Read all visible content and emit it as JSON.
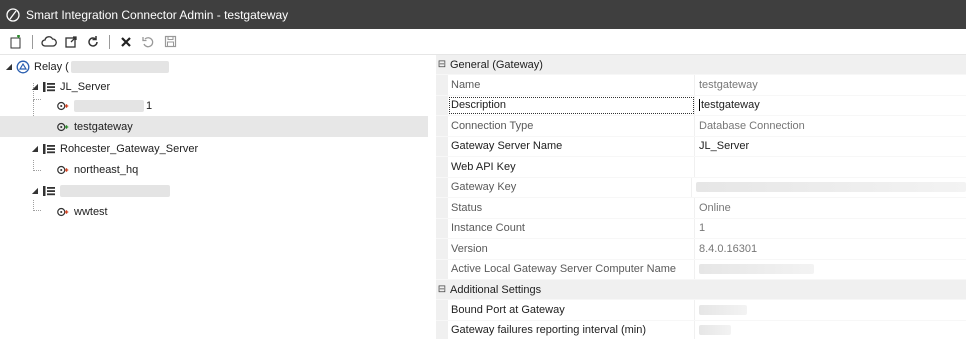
{
  "window": {
    "title": "Smart Integration Connector Admin - testgateway"
  },
  "toolbar": {
    "buttons": [
      "new-icon",
      "cloud-icon",
      "open-external-icon",
      "refresh-icon",
      "delete-icon",
      "undo-icon",
      "save-icon"
    ]
  },
  "tree": {
    "root": {
      "label": "Relay ("
    },
    "servers": [
      {
        "label": "JL_Server",
        "gateways": [
          {
            "label": "1"
          },
          {
            "label": "testgateway"
          }
        ]
      },
      {
        "label": "Rohcester_Gateway_Server",
        "gateways": [
          {
            "label": "northeast_hq"
          }
        ]
      },
      {
        "label": "",
        "gateways": [
          {
            "label": "wwtest"
          }
        ]
      }
    ]
  },
  "properties": {
    "general": {
      "header": "General (Gateway)",
      "rows": [
        {
          "name": "Name",
          "value": "testgateway"
        },
        {
          "name": "Description",
          "value": "testgateway"
        },
        {
          "name": "Connection Type",
          "value": "Database Connection"
        },
        {
          "name": "Gateway Server Name",
          "value": "JL_Server"
        },
        {
          "name": "Web API Key",
          "value": ""
        },
        {
          "name": "Gateway Key",
          "value": ""
        },
        {
          "name": "Status",
          "value": "Online"
        },
        {
          "name": "Instance Count",
          "value": "1"
        },
        {
          "name": "Version",
          "value": "8.4.0.16301"
        },
        {
          "name": "Active Local Gateway Server Computer Name",
          "value": ""
        }
      ]
    },
    "additional": {
      "header": "Additional Settings",
      "rows": [
        {
          "name": "Bound Port at Gateway",
          "value": ""
        },
        {
          "name": "Gateway failures reporting interval (min)",
          "value": ""
        }
      ]
    }
  }
}
